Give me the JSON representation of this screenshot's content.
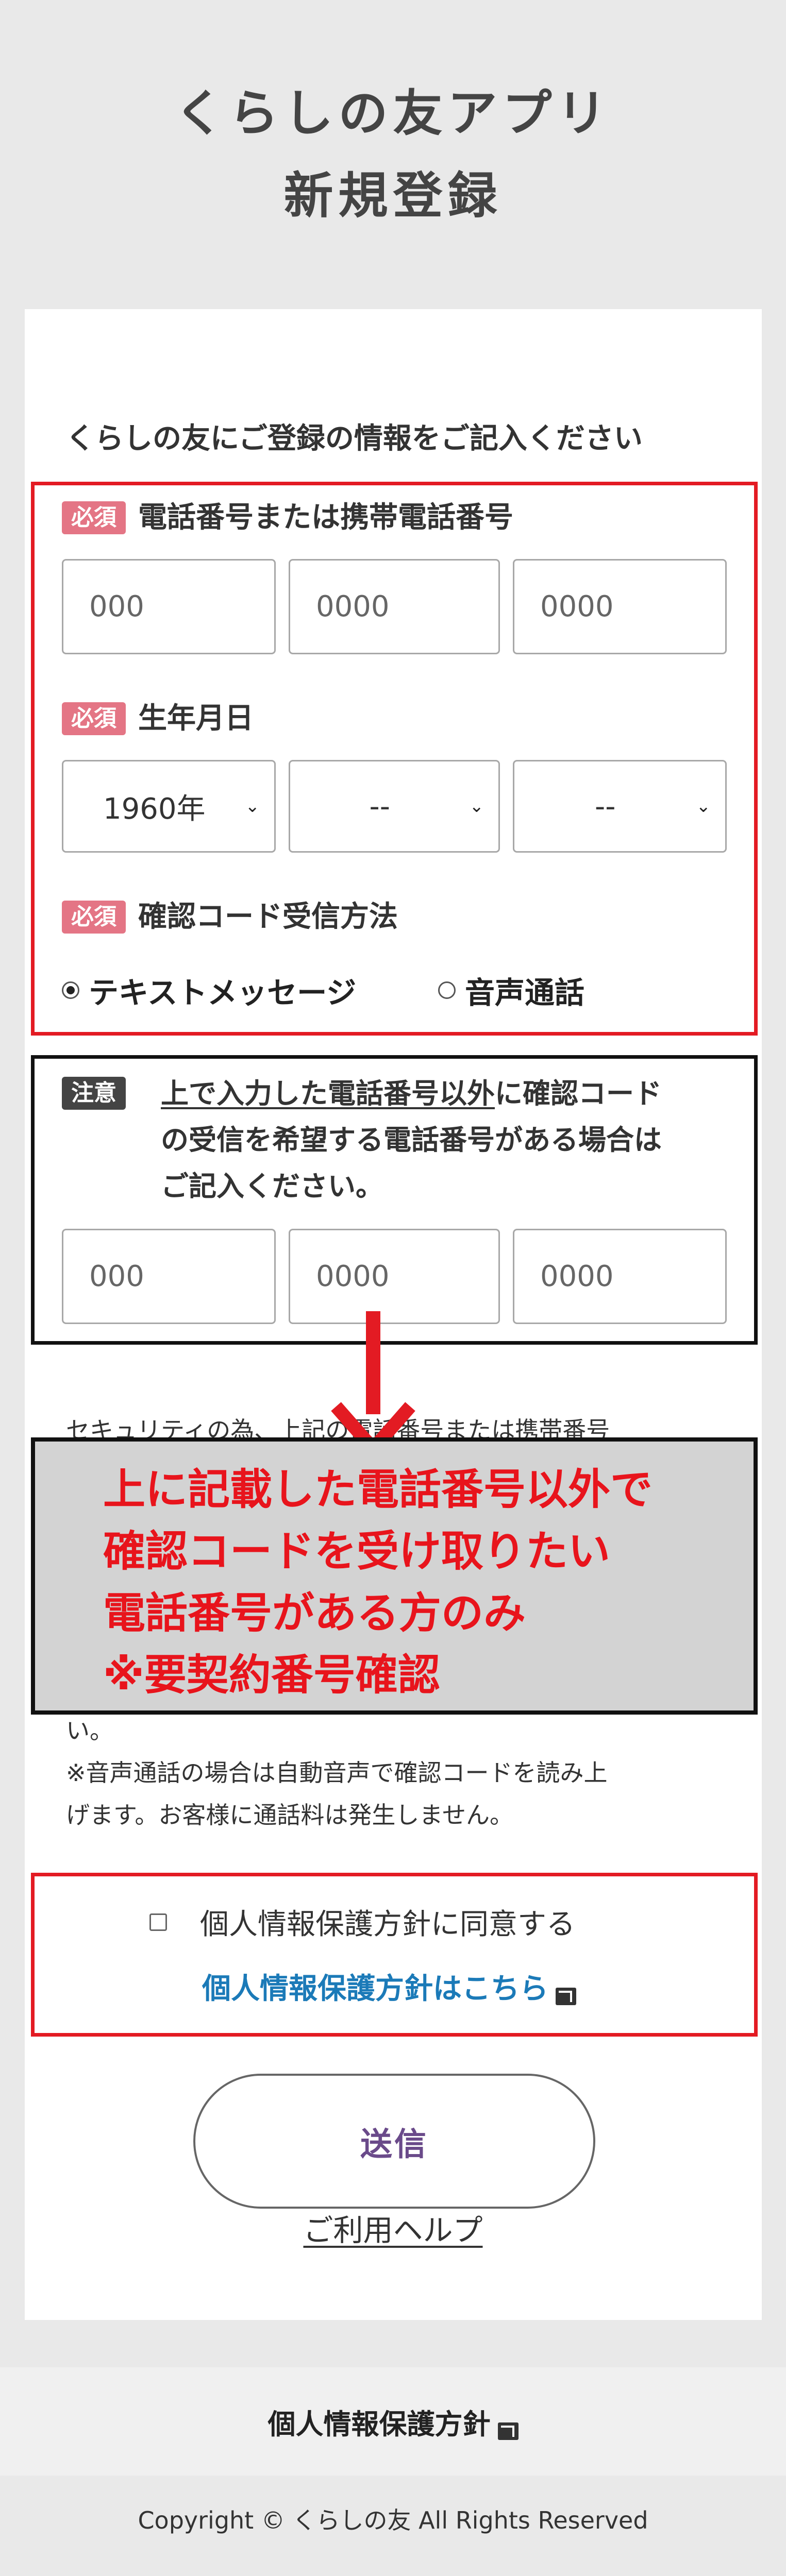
{
  "header": {
    "title_line1": "くらしの友アプリ",
    "title_line2": "新規登録"
  },
  "form": {
    "intro": "くらしの友にご登録の情報をご記入ください",
    "required_badge": "必須",
    "phone": {
      "label": "電話番号または携帯電話番号",
      "placeholders": [
        "000",
        "0000",
        "0000"
      ]
    },
    "birth": {
      "label": "生年月日",
      "year": "1960年",
      "month": "--",
      "day": "--"
    },
    "code_method": {
      "label": "確認コード受信方法",
      "option_sms": "テキストメッセージ",
      "option_voice": "音声通話",
      "selected": "テキストメッセージ"
    },
    "note": {
      "badge": "注意",
      "underlined": "上で入力した電話番号以外",
      "line1_rest": "に確認コード",
      "line2": "の受信を希望する電話番号がある場合は",
      "line3": "ご記入ください。",
      "placeholders": [
        "000",
        "0000",
        "0000"
      ]
    },
    "security_partial": "セキュリティの為、上記の電話番号または携帯番号",
    "security_tail": "い。",
    "voice_note_line1": "※音声通話の場合は自動音声で確認コードを読み上",
    "voice_note_line2": "げます。お客様に通話料は発生しません。",
    "consent_label": "個人情報保護方針に同意する",
    "policy_link": "個人情報保護方針はこちら",
    "submit": "送信",
    "help": "ご利用ヘルプ"
  },
  "annotation": {
    "lines": [
      "上に記載した電話番号以外で",
      "確認コードを受け取りたい",
      "電話番号がある方のみ",
      "※要契約番号確認"
    ],
    "color": "#e8141c"
  },
  "footer": {
    "policy": "個人情報保護方針",
    "copyright": "Copyright © くらしの友 All Rights Reserved"
  }
}
